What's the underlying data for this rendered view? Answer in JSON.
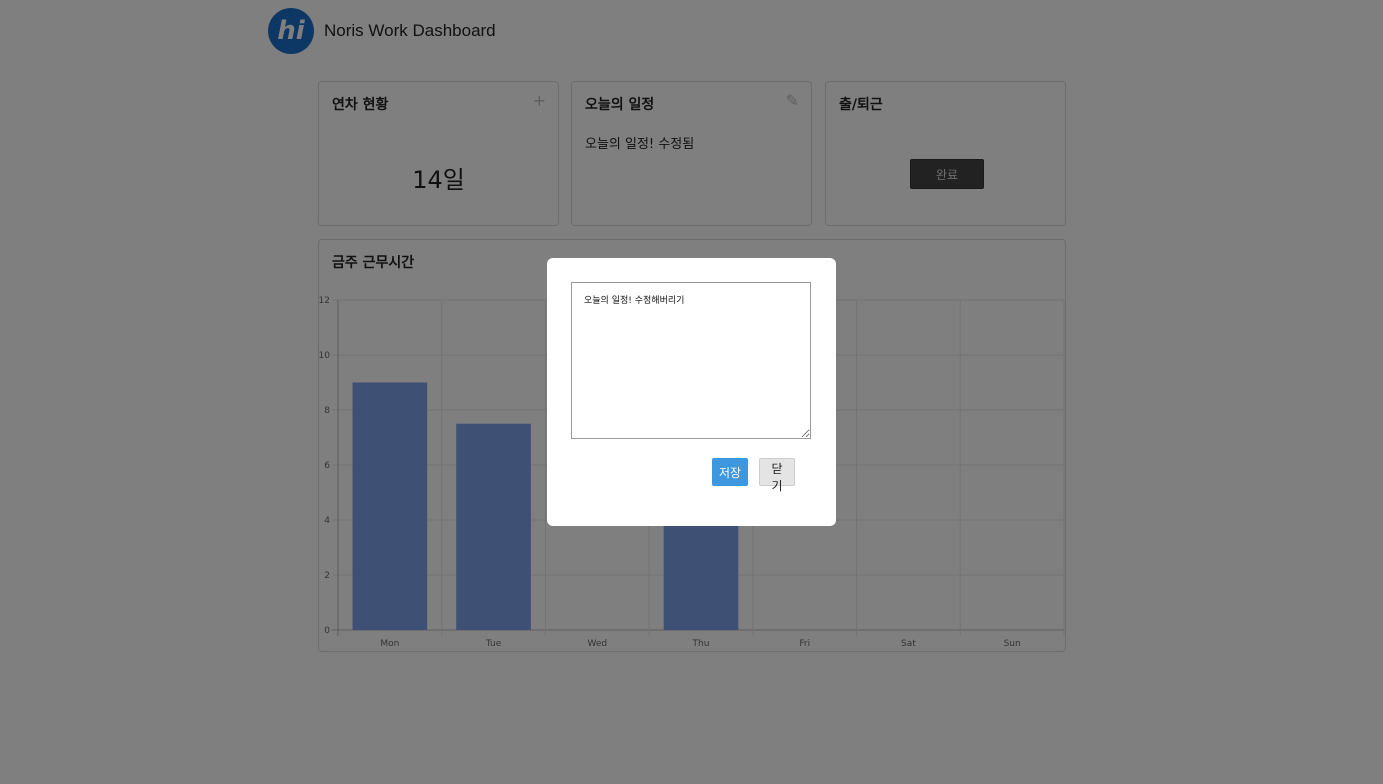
{
  "app": {
    "logo_text": "hi",
    "title": "Noris Work Dashboard"
  },
  "cards": {
    "leave": {
      "title": "연차 현황",
      "action_icon": "plus-icon",
      "action_glyph": "+",
      "value": "14일"
    },
    "schedule": {
      "title": "오늘의 일정",
      "action_icon": "pencil-icon",
      "action_glyph": "✎",
      "text": "오늘의 일정! 수정됨"
    },
    "attendance": {
      "title": "출/퇴근",
      "button_label": "완료"
    }
  },
  "chart_card": {
    "title": "금주 근무시간"
  },
  "chart_data": {
    "type": "bar",
    "categories": [
      "Mon",
      "Tue",
      "Wed",
      "Thu",
      "Fri",
      "Sat",
      "Sun"
    ],
    "values": [
      9,
      7.5,
      0,
      4,
      0,
      0,
      0
    ],
    "yticks": [
      "0",
      "2",
      "4",
      "6",
      "8",
      "10",
      "12"
    ],
    "ylim": [
      0,
      12
    ],
    "grid": true,
    "bar_color": "#7da3e8"
  },
  "modal": {
    "textarea_value": "오늘의 일정! 수정해버리기",
    "save_label": "저장",
    "close_label": "닫기"
  },
  "colors": {
    "accent": "#3d98e0",
    "logo": "#1a6ec8",
    "overlay": "rgba(0,0,0,0.5)"
  }
}
